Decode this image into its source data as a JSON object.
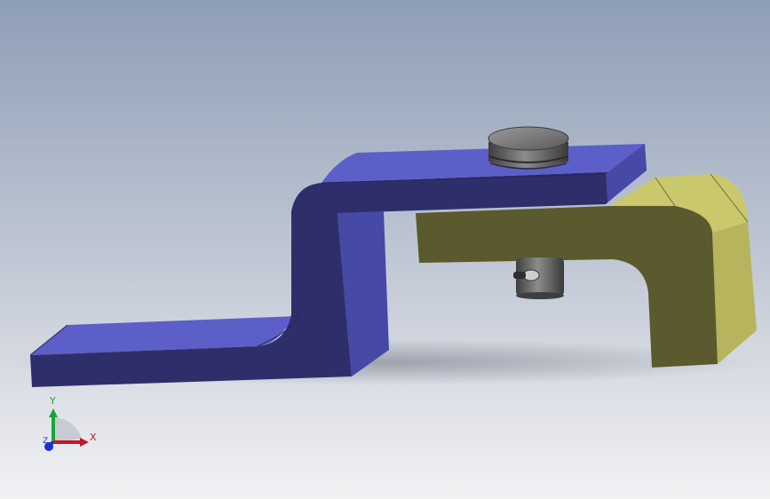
{
  "viewport": {
    "background_top": "#8e9eb6",
    "background_bottom": "#f2f2f4",
    "shadow_color": "#6f7480"
  },
  "model": {
    "blue_bracket": {
      "top_face": "#5d5fc9",
      "front_face": "#2e2f6a",
      "side_face": "#4649a6"
    },
    "yellow_bracket": {
      "top_face": "#c9c86c",
      "front_face": "#5a5a2e",
      "side_face": "#b6b55e"
    },
    "upper_pin": {
      "color": "#5e5e5e"
    },
    "lower_pin": {
      "color": "#6a6a6a"
    }
  },
  "triad": {
    "x_label": "X",
    "y_label": "Y",
    "z_label": "Z",
    "x_color": "#c0182a",
    "y_color": "#1aa33a",
    "z_color": "#1f2fd0"
  }
}
